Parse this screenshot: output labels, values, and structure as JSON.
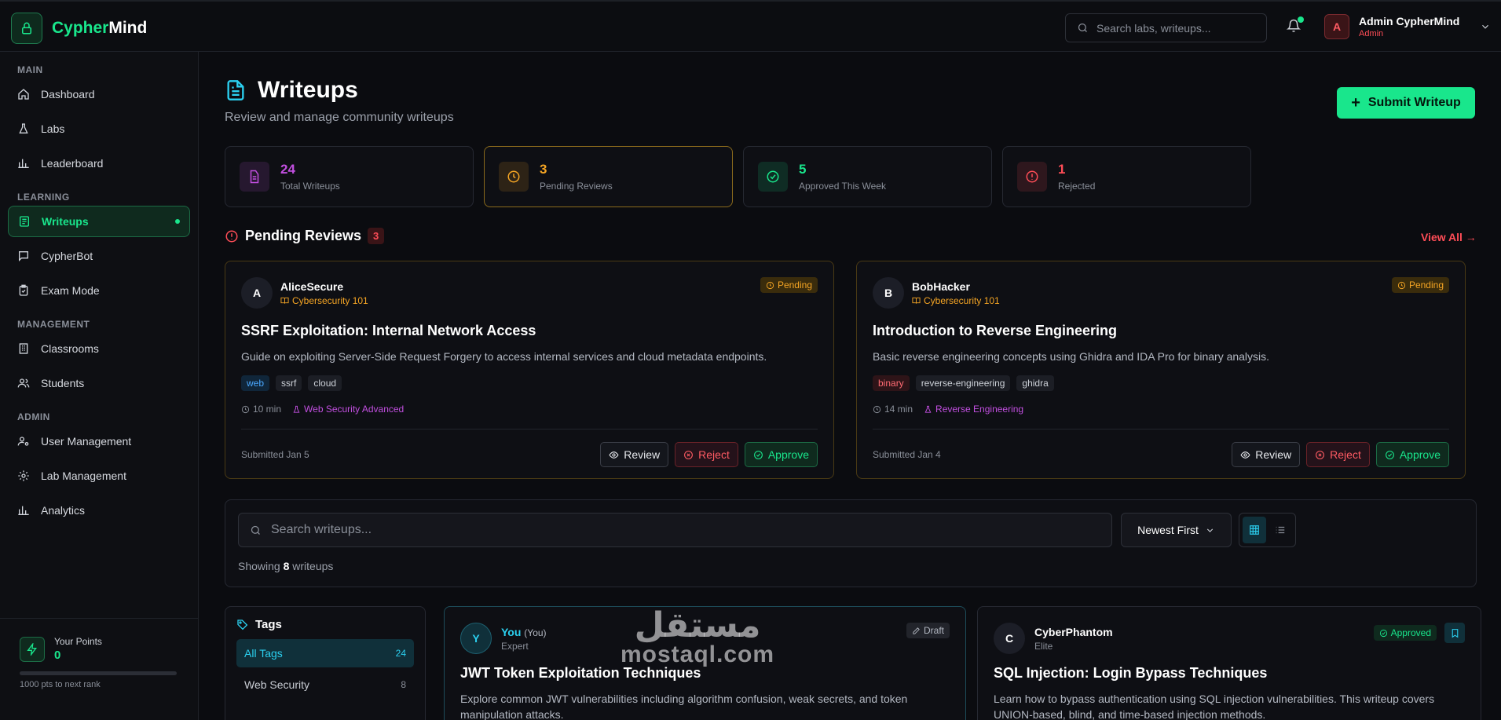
{
  "app": {
    "name_a": "Cypher",
    "name_b": "Mind"
  },
  "search": {
    "placeholder": "Search labs, writeups..."
  },
  "user": {
    "initial": "A",
    "name": "Admin CypherMind",
    "role": "Admin"
  },
  "sidebar": {
    "sections": [
      {
        "title": "MAIN",
        "items": [
          {
            "label": "Dashboard",
            "icon": "home-icon"
          },
          {
            "label": "Labs",
            "icon": "flask-icon"
          },
          {
            "label": "Leaderboard",
            "icon": "chart-icon"
          }
        ]
      },
      {
        "title": "LEARNING",
        "items": [
          {
            "label": "Writeups",
            "icon": "writeups-icon"
          },
          {
            "label": "CypherBot",
            "icon": "chat-icon"
          },
          {
            "label": "Exam Mode",
            "icon": "clipboard-icon"
          }
        ]
      },
      {
        "title": "MANAGEMENT",
        "items": [
          {
            "label": "Classrooms",
            "icon": "building-icon"
          },
          {
            "label": "Students",
            "icon": "users-icon"
          }
        ]
      },
      {
        "title": "ADMIN",
        "items": [
          {
            "label": "User Management",
            "icon": "user-cog-icon"
          },
          {
            "label": "Lab Management",
            "icon": "gear-icon"
          },
          {
            "label": "Analytics",
            "icon": "chart-icon"
          }
        ]
      }
    ],
    "points": {
      "label": "Your Points",
      "value": "0",
      "next": "1000 pts to next rank",
      "progress": 0
    }
  },
  "page": {
    "title": "Writeups",
    "subtitle": "Review and manage community writeups",
    "submit_label": "Submit Writeup"
  },
  "stats": [
    {
      "num": "24",
      "label": "Total Writeups",
      "color": "#c24fe0"
    },
    {
      "num": "3",
      "label": "Pending Reviews",
      "color": "#f5a524"
    },
    {
      "num": "5",
      "label": "Approved This Week",
      "color": "#19e68c"
    },
    {
      "num": "1",
      "label": "Rejected",
      "color": "#ff4d57"
    }
  ],
  "pending": {
    "title": "Pending Reviews",
    "count": "3",
    "view_all": "View All →",
    "cards": [
      {
        "initial": "A",
        "author": "AliceSecure",
        "course": "Cybersecurity 101",
        "status": "Pending",
        "title": "SSRF Exploitation: Internal Network Access",
        "desc": "Guide on exploiting Server-Side Request Forgery to access internal services and cloud metadata endpoints.",
        "tags": [
          "web",
          "ssrf",
          "cloud"
        ],
        "time": "10 min",
        "lab": "Web Security Advanced",
        "submitted": "Submitted Jan 5"
      },
      {
        "initial": "B",
        "author": "BobHacker",
        "course": "Cybersecurity 101",
        "status": "Pending",
        "title": "Introduction to Reverse Engineering",
        "desc": "Basic reverse engineering concepts using Ghidra and IDA Pro for binary analysis.",
        "tags": [
          "binary",
          "reverse-engineering",
          "ghidra"
        ],
        "time": "14 min",
        "lab": "Reverse Engineering",
        "submitted": "Submitted Jan 4"
      }
    ],
    "review_label": "Review",
    "reject_label": "Reject",
    "approve_label": "Approve"
  },
  "filter": {
    "placeholder": "Search writeups...",
    "sort": "Newest First",
    "showing_pre": "Showing",
    "showing_count": "8",
    "showing_post": "writeups"
  },
  "tags_panel": {
    "title": "Tags",
    "items": [
      {
        "label": "All Tags",
        "count": "24"
      },
      {
        "label": "Web Security",
        "count": "8"
      }
    ]
  },
  "writeups": [
    {
      "initial": "Y",
      "author": "You",
      "you": "(You)",
      "level": "Expert",
      "status": "Draft",
      "title": "JWT Token Exploitation Techniques",
      "desc": "Explore common JWT vulnerabilities including algorithm confusion, weak secrets, and token manipulation attacks."
    },
    {
      "initial": "C",
      "author": "CyberPhantom",
      "level": "Elite",
      "status": "Approved",
      "title": "SQL Injection: Login Bypass Techniques",
      "desc": "Learn how to bypass authentication using SQL injection vulnerabilities. This writeup covers UNION-based, blind, and time-based injection methods."
    }
  ],
  "watermark": {
    "arabic": "مستقل",
    "latin": "mostaql.com"
  }
}
